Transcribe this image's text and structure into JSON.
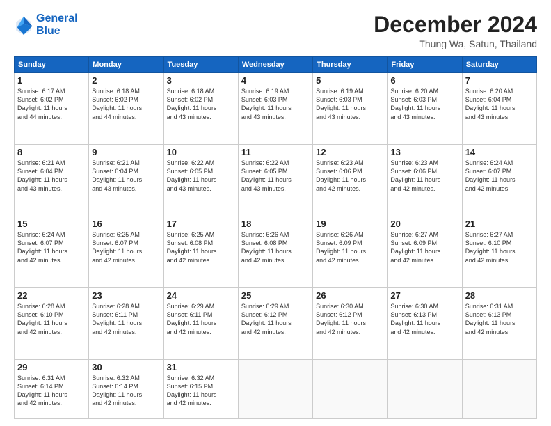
{
  "logo": {
    "line1": "General",
    "line2": "Blue"
  },
  "title": "December 2024",
  "subtitle": "Thung Wa, Satun, Thailand",
  "days_of_week": [
    "Sunday",
    "Monday",
    "Tuesday",
    "Wednesday",
    "Thursday",
    "Friday",
    "Saturday"
  ],
  "weeks": [
    [
      {
        "day": "1",
        "info": "Sunrise: 6:17 AM\nSunset: 6:02 PM\nDaylight: 11 hours\nand 44 minutes."
      },
      {
        "day": "2",
        "info": "Sunrise: 6:18 AM\nSunset: 6:02 PM\nDaylight: 11 hours\nand 44 minutes."
      },
      {
        "day": "3",
        "info": "Sunrise: 6:18 AM\nSunset: 6:02 PM\nDaylight: 11 hours\nand 43 minutes."
      },
      {
        "day": "4",
        "info": "Sunrise: 6:19 AM\nSunset: 6:03 PM\nDaylight: 11 hours\nand 43 minutes."
      },
      {
        "day": "5",
        "info": "Sunrise: 6:19 AM\nSunset: 6:03 PM\nDaylight: 11 hours\nand 43 minutes."
      },
      {
        "day": "6",
        "info": "Sunrise: 6:20 AM\nSunset: 6:03 PM\nDaylight: 11 hours\nand 43 minutes."
      },
      {
        "day": "7",
        "info": "Sunrise: 6:20 AM\nSunset: 6:04 PM\nDaylight: 11 hours\nand 43 minutes."
      }
    ],
    [
      {
        "day": "8",
        "info": "Sunrise: 6:21 AM\nSunset: 6:04 PM\nDaylight: 11 hours\nand 43 minutes."
      },
      {
        "day": "9",
        "info": "Sunrise: 6:21 AM\nSunset: 6:04 PM\nDaylight: 11 hours\nand 43 minutes."
      },
      {
        "day": "10",
        "info": "Sunrise: 6:22 AM\nSunset: 6:05 PM\nDaylight: 11 hours\nand 43 minutes."
      },
      {
        "day": "11",
        "info": "Sunrise: 6:22 AM\nSunset: 6:05 PM\nDaylight: 11 hours\nand 43 minutes."
      },
      {
        "day": "12",
        "info": "Sunrise: 6:23 AM\nSunset: 6:06 PM\nDaylight: 11 hours\nand 42 minutes."
      },
      {
        "day": "13",
        "info": "Sunrise: 6:23 AM\nSunset: 6:06 PM\nDaylight: 11 hours\nand 42 minutes."
      },
      {
        "day": "14",
        "info": "Sunrise: 6:24 AM\nSunset: 6:07 PM\nDaylight: 11 hours\nand 42 minutes."
      }
    ],
    [
      {
        "day": "15",
        "info": "Sunrise: 6:24 AM\nSunset: 6:07 PM\nDaylight: 11 hours\nand 42 minutes."
      },
      {
        "day": "16",
        "info": "Sunrise: 6:25 AM\nSunset: 6:07 PM\nDaylight: 11 hours\nand 42 minutes."
      },
      {
        "day": "17",
        "info": "Sunrise: 6:25 AM\nSunset: 6:08 PM\nDaylight: 11 hours\nand 42 minutes."
      },
      {
        "day": "18",
        "info": "Sunrise: 6:26 AM\nSunset: 6:08 PM\nDaylight: 11 hours\nand 42 minutes."
      },
      {
        "day": "19",
        "info": "Sunrise: 6:26 AM\nSunset: 6:09 PM\nDaylight: 11 hours\nand 42 minutes."
      },
      {
        "day": "20",
        "info": "Sunrise: 6:27 AM\nSunset: 6:09 PM\nDaylight: 11 hours\nand 42 minutes."
      },
      {
        "day": "21",
        "info": "Sunrise: 6:27 AM\nSunset: 6:10 PM\nDaylight: 11 hours\nand 42 minutes."
      }
    ],
    [
      {
        "day": "22",
        "info": "Sunrise: 6:28 AM\nSunset: 6:10 PM\nDaylight: 11 hours\nand 42 minutes."
      },
      {
        "day": "23",
        "info": "Sunrise: 6:28 AM\nSunset: 6:11 PM\nDaylight: 11 hours\nand 42 minutes."
      },
      {
        "day": "24",
        "info": "Sunrise: 6:29 AM\nSunset: 6:11 PM\nDaylight: 11 hours\nand 42 minutes."
      },
      {
        "day": "25",
        "info": "Sunrise: 6:29 AM\nSunset: 6:12 PM\nDaylight: 11 hours\nand 42 minutes."
      },
      {
        "day": "26",
        "info": "Sunrise: 6:30 AM\nSunset: 6:12 PM\nDaylight: 11 hours\nand 42 minutes."
      },
      {
        "day": "27",
        "info": "Sunrise: 6:30 AM\nSunset: 6:13 PM\nDaylight: 11 hours\nand 42 minutes."
      },
      {
        "day": "28",
        "info": "Sunrise: 6:31 AM\nSunset: 6:13 PM\nDaylight: 11 hours\nand 42 minutes."
      }
    ],
    [
      {
        "day": "29",
        "info": "Sunrise: 6:31 AM\nSunset: 6:14 PM\nDaylight: 11 hours\nand 42 minutes."
      },
      {
        "day": "30",
        "info": "Sunrise: 6:32 AM\nSunset: 6:14 PM\nDaylight: 11 hours\nand 42 minutes."
      },
      {
        "day": "31",
        "info": "Sunrise: 6:32 AM\nSunset: 6:15 PM\nDaylight: 11 hours\nand 42 minutes."
      },
      {
        "day": "",
        "info": ""
      },
      {
        "day": "",
        "info": ""
      },
      {
        "day": "",
        "info": ""
      },
      {
        "day": "",
        "info": ""
      }
    ]
  ]
}
